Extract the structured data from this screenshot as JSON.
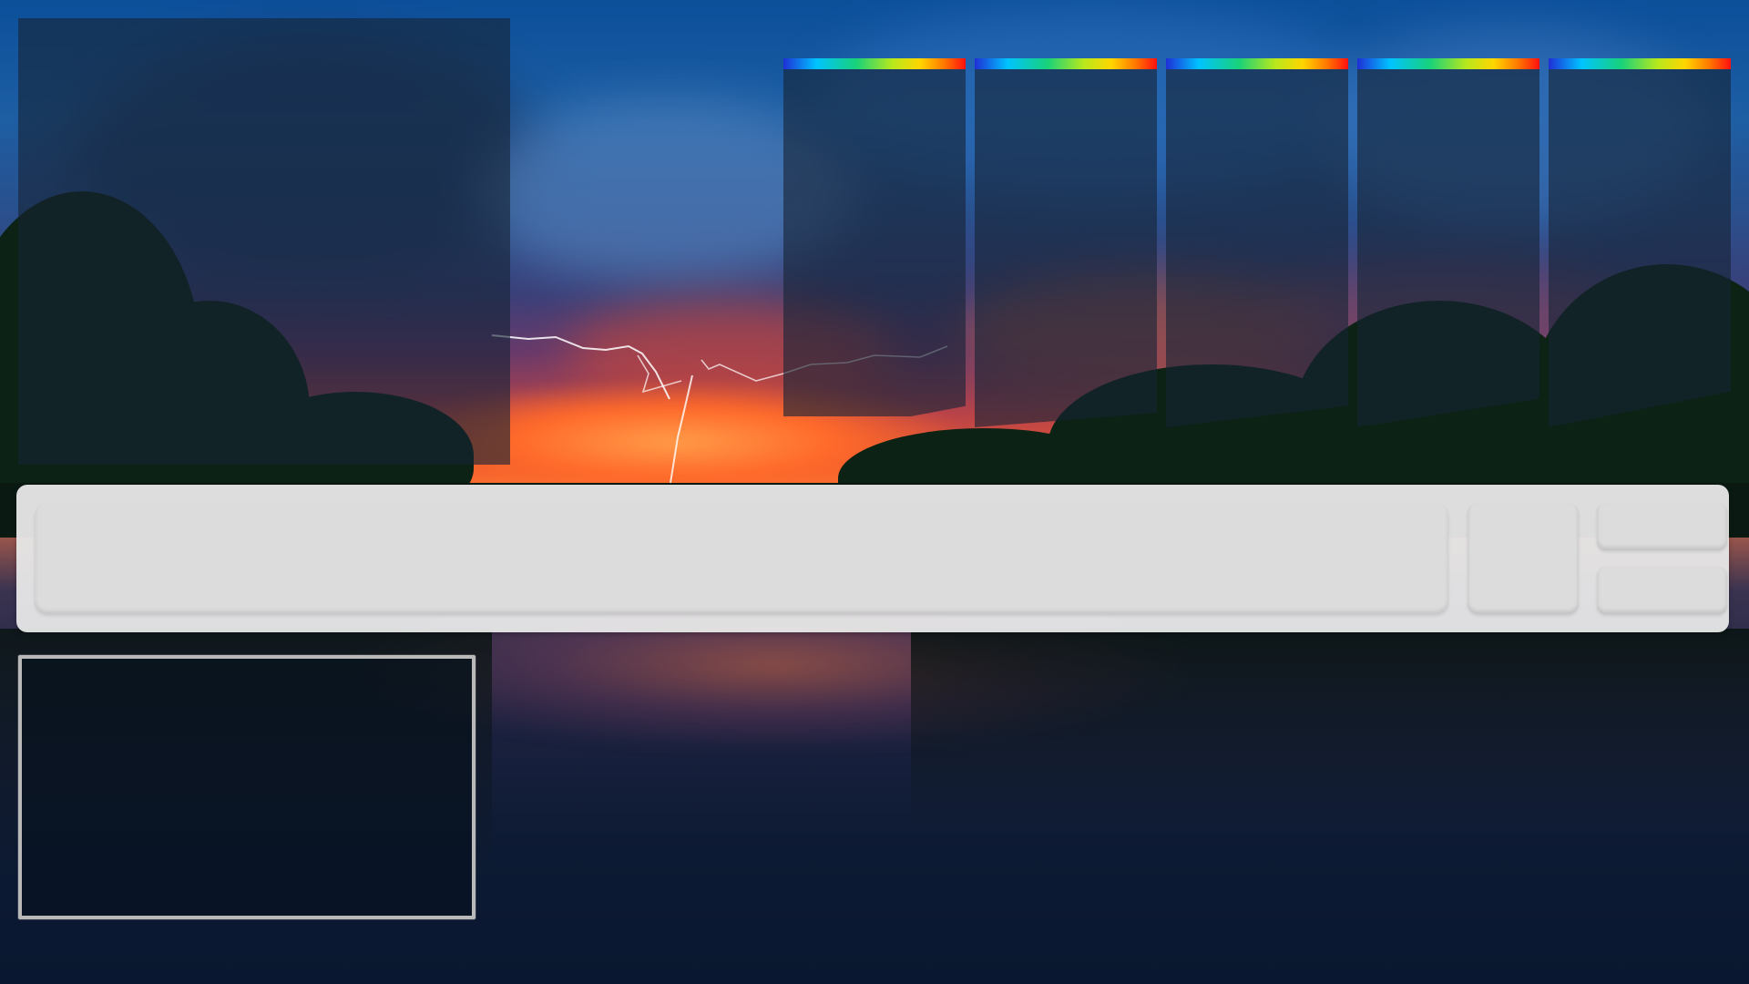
{
  "search": {
    "value": "",
    "placeholder": ""
  },
  "colors": {
    "panel_tint": "#162436",
    "toolbar_bg": "#e8e8e8",
    "control_bg": "#dcdcdc",
    "preview_border": "#b9b9b9",
    "stripe_gradient": [
      "#1f2fd6",
      "#00c3ff",
      "#18d27a",
      "#b8e81c",
      "#ffd500",
      "#ff7a00",
      "#ff1010"
    ]
  },
  "tiles": [
    {
      "id": 1
    },
    {
      "id": 2
    },
    {
      "id": 3
    },
    {
      "id": 4
    },
    {
      "id": 5
    }
  ]
}
